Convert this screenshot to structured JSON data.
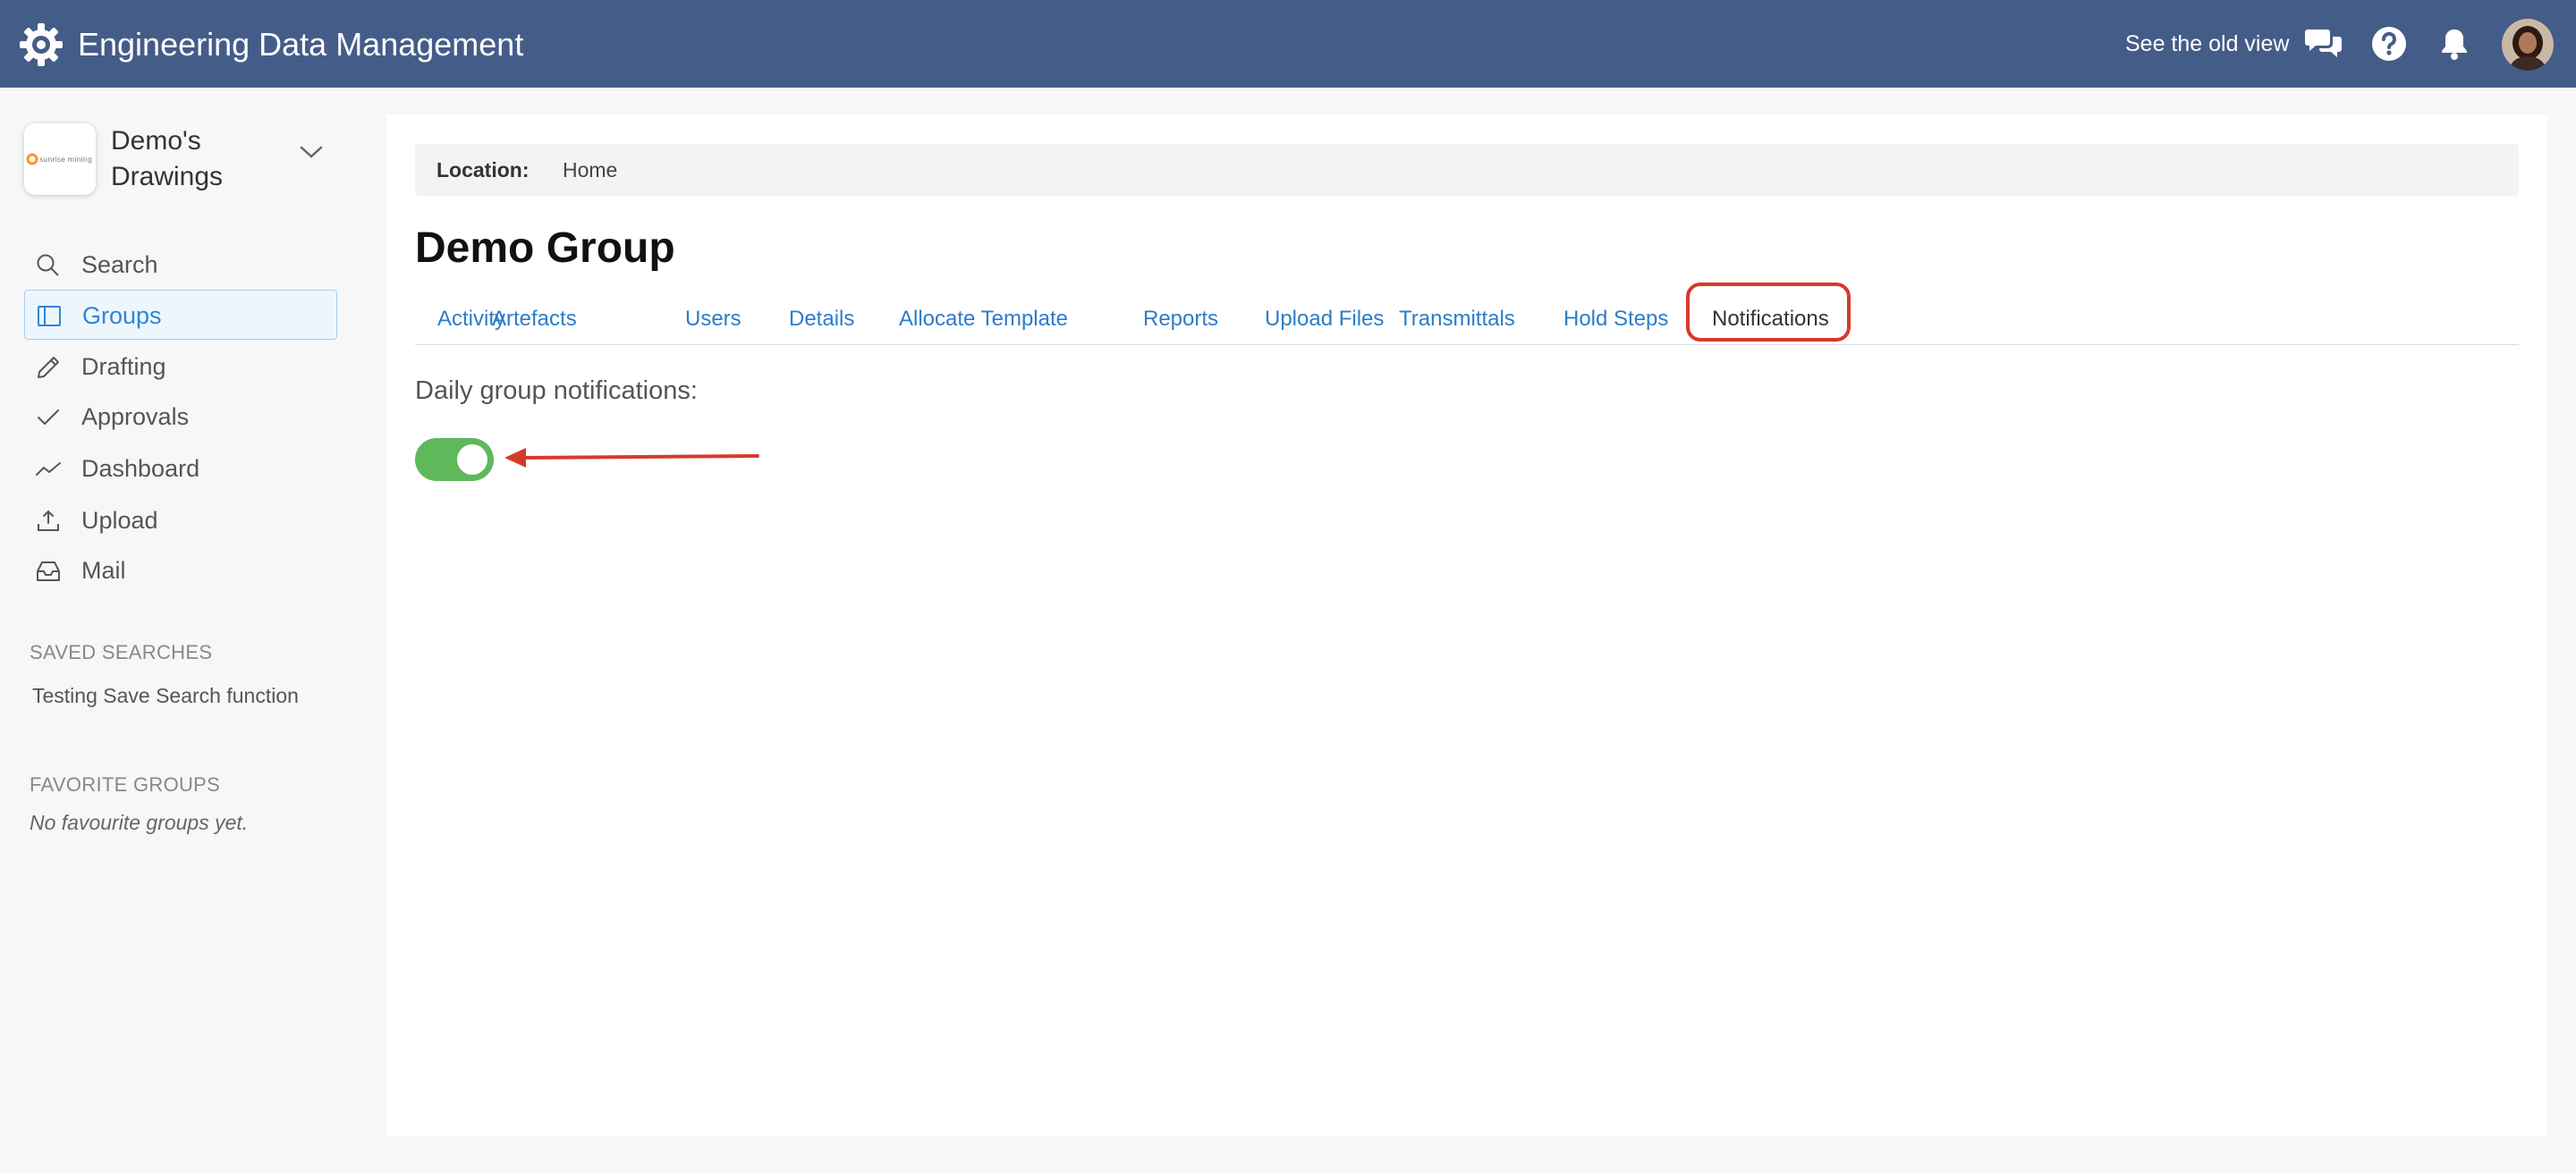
{
  "app": {
    "title": "Engineering Data Management",
    "old_view_label": "See the old view",
    "accent_color": "#445c88"
  },
  "header_icons": [
    "chat-icon",
    "help-icon",
    "bell-icon",
    "user-avatar"
  ],
  "sidebar": {
    "org_name": "Demo's Drawings",
    "org_logo_text": "sunrise mining",
    "nav": [
      {
        "label": "Search",
        "icon": "search-icon"
      },
      {
        "label": "Groups",
        "icon": "groups-icon",
        "active": true
      },
      {
        "label": "Drafting",
        "icon": "pencil-icon"
      },
      {
        "label": "Approvals",
        "icon": "check-icon"
      },
      {
        "label": "Dashboard",
        "icon": "chart-line-icon"
      },
      {
        "label": "Upload",
        "icon": "upload-icon"
      },
      {
        "label": "Mail",
        "icon": "inbox-icon"
      }
    ],
    "saved_searches_heading": "SAVED SEARCHES",
    "saved_searches": [
      "Testing Save Search function"
    ],
    "favorite_groups_heading": "FAVORITE GROUPS",
    "favorite_groups_empty": "No favourite groups yet."
  },
  "main": {
    "location_label": "Location:",
    "location_value": "Home",
    "page_title": "Demo Group",
    "tabs": [
      {
        "label": "Activity"
      },
      {
        "label": "Artefacts"
      },
      {
        "label": "Users"
      },
      {
        "label": "Details"
      },
      {
        "label": "Allocate Template"
      },
      {
        "label": "Reports"
      },
      {
        "label": "Upload Files"
      },
      {
        "label": "Transmittals"
      },
      {
        "label": "Hold Steps"
      },
      {
        "label": "Notifications",
        "active": true
      }
    ],
    "notifications_label": "Daily group notifications:",
    "daily_notifications_enabled": true,
    "toggle_color": "#5fb85a",
    "annotation_color": "#d63a2b"
  }
}
